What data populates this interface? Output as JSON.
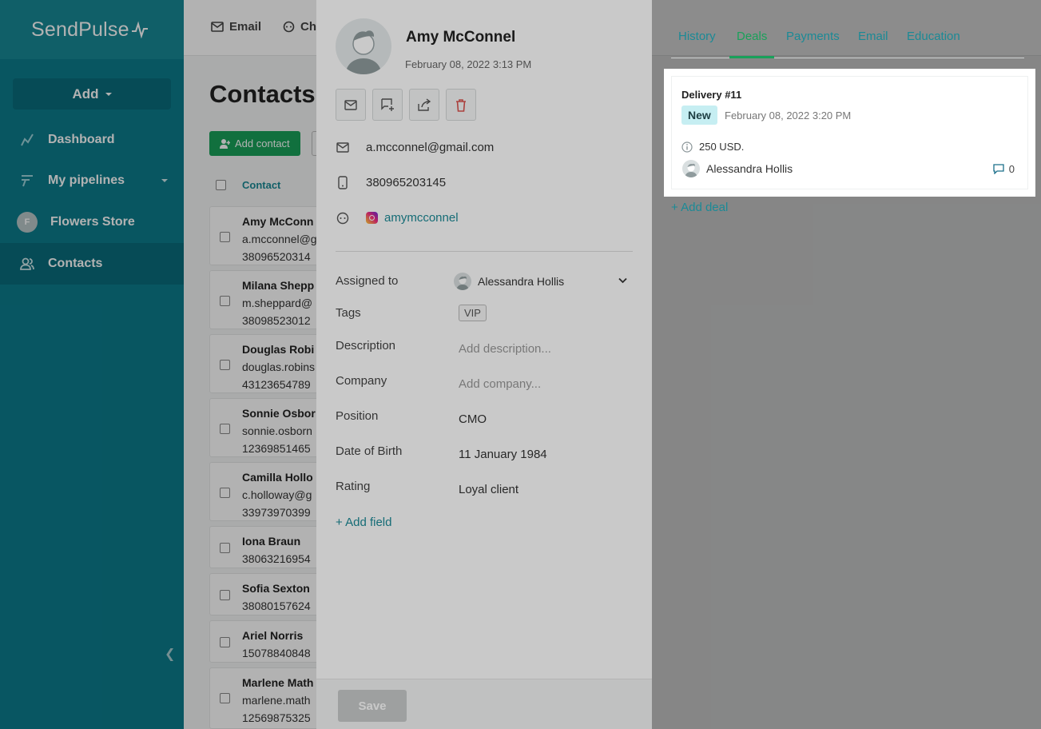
{
  "app": {
    "logo_text": "SendPulse"
  },
  "sidebar": {
    "add_label": "Add",
    "items": [
      {
        "label": "Dashboard",
        "icon": "chart-line-icon"
      },
      {
        "label": "My pipelines",
        "icon": "pipeline-icon"
      },
      {
        "label": "Flowers Store",
        "avatar_letter": "F"
      },
      {
        "label": "Contacts",
        "icon": "contacts-icon",
        "active": true
      }
    ]
  },
  "topbar": {
    "email": "Email",
    "chat": "Ch"
  },
  "page": {
    "title": "Contacts",
    "add_contact": "Add contact",
    "column_contact": "Contact",
    "rows": [
      {
        "name": "Amy McConn",
        "email": "a.mcconnel@g",
        "phone": "38096520314"
      },
      {
        "name": "Milana Shepp",
        "email": "m.sheppard@",
        "phone": "38098523012"
      },
      {
        "name": "Douglas Robi",
        "email": "douglas.robins",
        "phone": "43123654789"
      },
      {
        "name": "Sonnie Osbor",
        "email": "sonnie.osborn",
        "phone": "12369851465"
      },
      {
        "name": "Camilla Hollo",
        "email": "c.holloway@g",
        "phone": "33973970399"
      },
      {
        "name": "Iona Braun",
        "phone": "38063216954"
      },
      {
        "name": "Sofia Sexton",
        "phone": "38080157624"
      },
      {
        "name": "Ariel Norris",
        "phone": "15078840848"
      },
      {
        "name": "Marlene Math",
        "email": "marlene.math",
        "phone": "12569875325"
      }
    ]
  },
  "contact": {
    "name": "Amy McConnel",
    "created": "February 08, 2022 3:13 PM",
    "email": "a.mcconnel@gmail.com",
    "phone": "380965203145",
    "instagram": "amymcconnel",
    "fields": {
      "assigned_label": "Assigned to",
      "assigned_value": "Alessandra Hollis",
      "tags_label": "Tags",
      "tag_value": "VIP",
      "description_label": "Description",
      "description_placeholder": "Add description...",
      "company_label": "Company",
      "company_placeholder": "Add company...",
      "position_label": "Position",
      "position_value": "CMO",
      "dob_label": "Date of Birth",
      "dob_value": "11 January 1984",
      "rating_label": "Rating",
      "rating_value": "Loyal client"
    },
    "add_field": "+ Add field",
    "save": "Save"
  },
  "tabs": [
    "History",
    "Deals",
    "Payments",
    "Email",
    "Education"
  ],
  "active_tab": "Deals",
  "deal": {
    "title": "Delivery #11",
    "status": "New",
    "date": "February 08, 2022 3:20 PM",
    "amount": "250 USD.",
    "owner": "Alessandra Hollis",
    "comments": "0"
  },
  "add_deal": "+ Add deal",
  "colors": {
    "sidebar": "#0c7b8c",
    "accent_green": "#19a15a",
    "link_teal": "#1b8a96",
    "delete_red": "#d9534f"
  }
}
